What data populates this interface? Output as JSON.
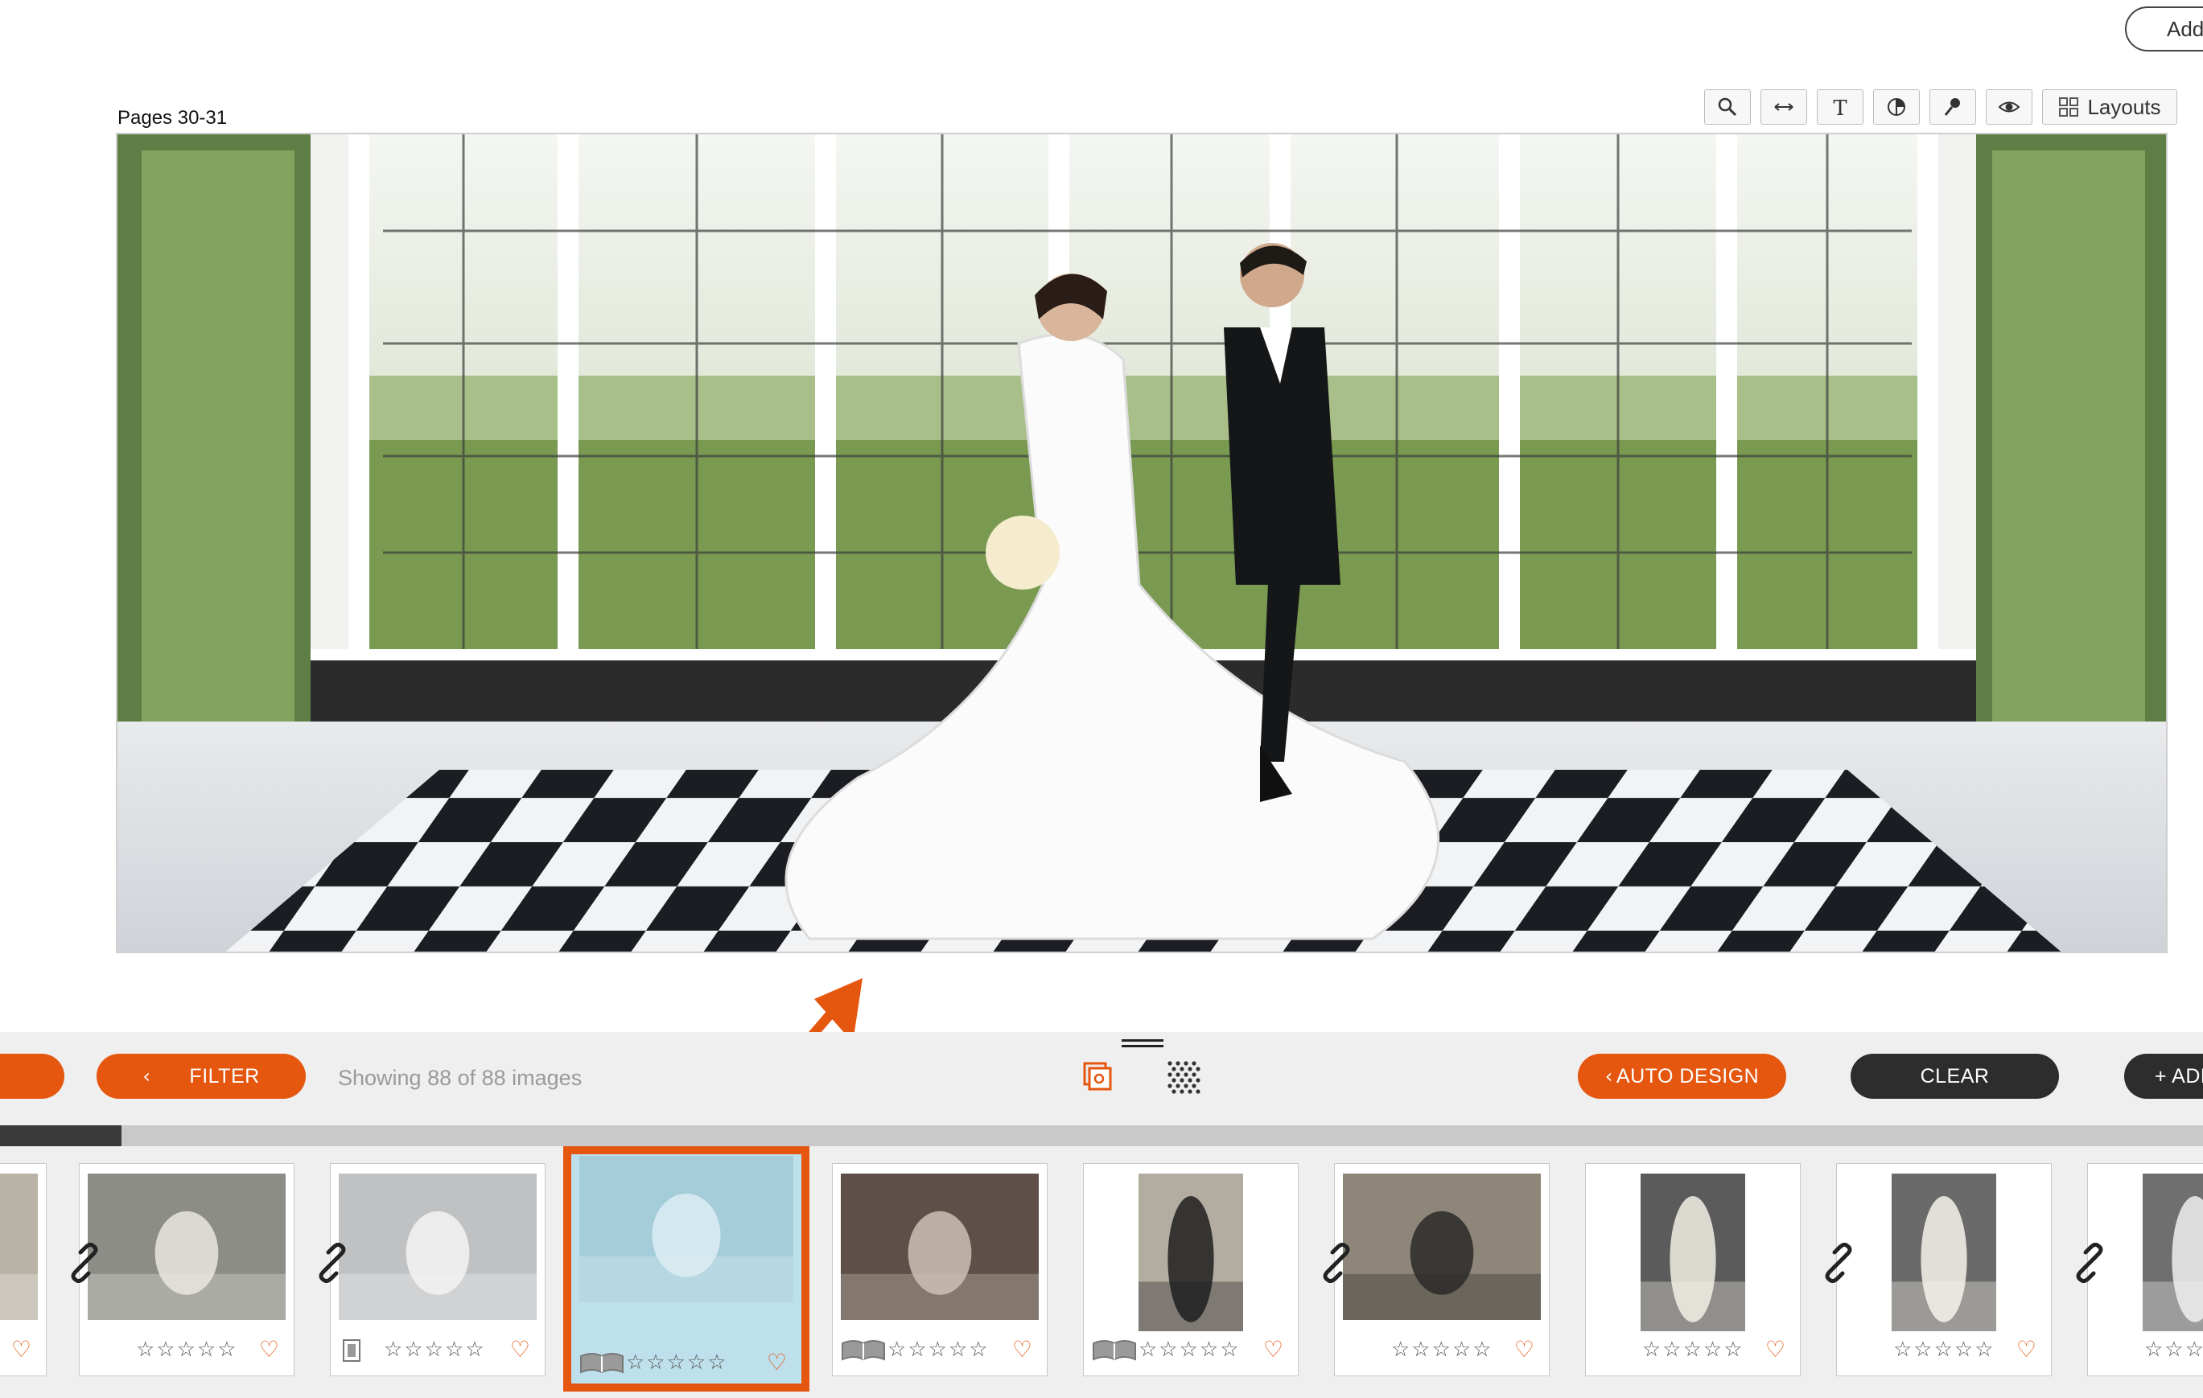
{
  "header": {
    "add_button_label": "Add"
  },
  "spread": {
    "pages_label": "Pages 30-31"
  },
  "toolbar": {
    "tools": [
      {
        "name": "zoom-icon"
      },
      {
        "name": "swap-horizontal-icon"
      },
      {
        "name": "text-icon"
      },
      {
        "name": "color-adjust-icon"
      },
      {
        "name": "pin-icon"
      },
      {
        "name": "preview-eye-icon"
      }
    ],
    "layouts_label": "Layouts"
  },
  "panel": {
    "filter_label": "FILTER",
    "showing_text": "Showing 88 of 88 images",
    "auto_design_label": "AUTO DESIGN",
    "clear_label": "CLEAR",
    "add_label": "+ ADD",
    "progress_fraction": 0.055
  },
  "thumbnails": [
    {
      "stars": "☆☆☆☆☆",
      "favorite": "♡",
      "page_indicator": "none"
    },
    {
      "stars": "☆☆☆☆☆",
      "favorite": "♡",
      "page_indicator": "none"
    },
    {
      "stars": "☆☆☆☆☆",
      "favorite": "♡",
      "page_indicator": "single-page"
    },
    {
      "stars": "☆☆☆☆☆",
      "favorite": "♡",
      "page_indicator": "spread",
      "selected": true
    },
    {
      "stars": "☆☆☆☆☆",
      "favorite": "♡",
      "page_indicator": "spread"
    },
    {
      "stars": "☆☆☆☆☆",
      "favorite": "♡",
      "page_indicator": "spread"
    },
    {
      "stars": "☆☆☆☆☆",
      "favorite": "♡",
      "page_indicator": "none"
    },
    {
      "stars": "☆☆☆☆☆",
      "favorite": "♡",
      "page_indicator": "none"
    },
    {
      "stars": "☆☆☆☆☆",
      "favorite": "♡",
      "page_indicator": "none"
    },
    {
      "stars": "☆☆☆",
      "favorite": "",
      "page_indicator": "none"
    }
  ],
  "colors": {
    "accent": "#e5560f",
    "dark": "#2d2d2d",
    "selected_bg": "#bde0ec"
  }
}
